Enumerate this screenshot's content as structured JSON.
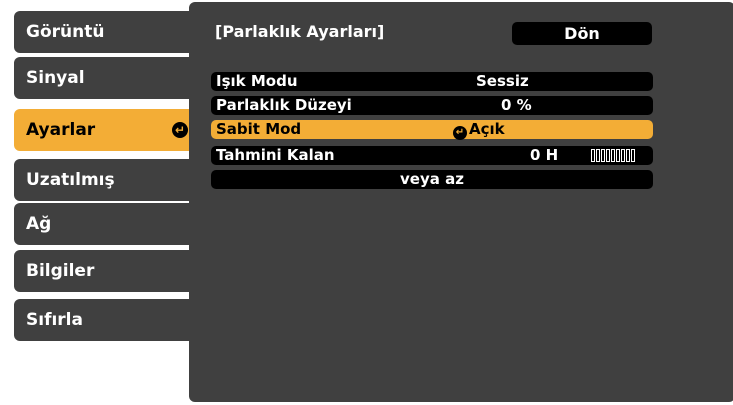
{
  "sidebar": {
    "items": [
      {
        "label": "Görüntü"
      },
      {
        "label": "Sinyal"
      },
      {
        "label": "Ayarlar",
        "active": true
      },
      {
        "label": "Uzatılmış"
      },
      {
        "label": "Ağ"
      },
      {
        "label": "Bilgiler"
      },
      {
        "label": "Sıfırla"
      }
    ]
  },
  "panel": {
    "title": "[Parlaklık Ayarları]",
    "back_label": "Dön",
    "rows": [
      {
        "label": "Işık Modu",
        "value": "Sessiz"
      },
      {
        "label": "Parlaklık Düzeyi",
        "value": "0 %"
      },
      {
        "label": "Sabit Mod",
        "value": "Açık"
      },
      {
        "label": "Tahmini Kalan",
        "value": "0 H"
      },
      {
        "label": "",
        "value": "veya az"
      }
    ]
  },
  "colors": {
    "accent": "#f3ad36",
    "panel": "#404040",
    "row": "#000000"
  },
  "icons": {
    "enter": "enter-return-icon"
  }
}
